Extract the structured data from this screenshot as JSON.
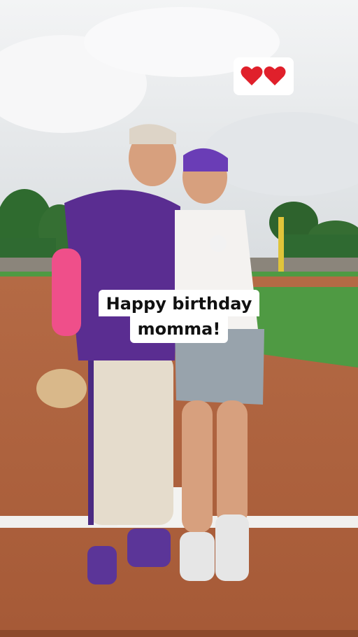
{
  "overlay": {
    "caption_line1": "Happy birthday",
    "caption_line2": "momma!",
    "sticker_icon": "two-red-hearts"
  },
  "colors": {
    "sky": "#e8ecef",
    "grass": "#4f9a43",
    "dirt": "#b1643f",
    "jersey_purple": "#5a2d91",
    "cap_purple": "#6a3db6",
    "heart_red": "#e0202b"
  }
}
